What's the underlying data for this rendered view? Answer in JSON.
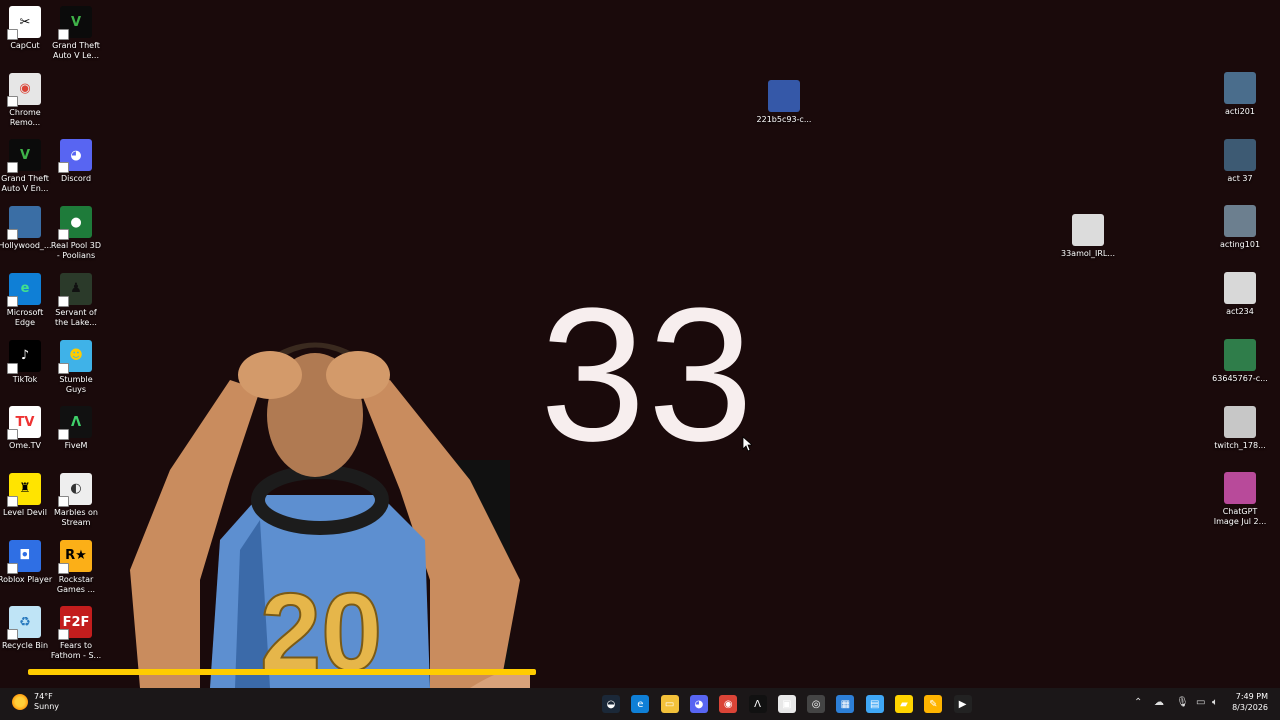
{
  "desktop_icons_left": [
    {
      "label": "CapCut",
      "icon": "capcut-icon",
      "color": "#ffffff",
      "glyph": "✂",
      "fg": "#000",
      "x": 0,
      "y": 0
    },
    {
      "label": "Grand Theft\nAuto V Le...",
      "icon": "gta-v-icon",
      "color": "#0b0b0b",
      "glyph": "V",
      "fg": "#3fb249",
      "x": 1,
      "y": 0
    },
    {
      "label": "Chrome\nRemo...",
      "icon": "chrome-remote-icon",
      "color": "#e6e6e6",
      "glyph": "◉",
      "fg": "#db4437",
      "x": 0,
      "y": 1
    },
    {
      "label": "Grand Theft\nAuto V En...",
      "icon": "gta-v-enhanced-icon",
      "color": "#0b0b0b",
      "glyph": "V",
      "fg": "#3fb249",
      "x": 0,
      "y": 2
    },
    {
      "label": "Discord",
      "icon": "discord-icon",
      "color": "#5865f2",
      "glyph": "◕",
      "fg": "#fff",
      "x": 1,
      "y": 2
    },
    {
      "label": "Hollywood_...",
      "icon": "hollywood-image-icon",
      "color": "#3a6ea5",
      "glyph": "",
      "fg": "#fff",
      "x": 0,
      "y": 3
    },
    {
      "label": "Real Pool 3D\n- Poolians",
      "icon": "real-pool-icon",
      "color": "#1e7b3a",
      "glyph": "●",
      "fg": "#fff",
      "x": 1,
      "y": 3
    },
    {
      "label": "Microsoft\nEdge",
      "icon": "edge-icon",
      "color": "#0f7fd6",
      "glyph": "e",
      "fg": "#41e08f",
      "x": 0,
      "y": 4
    },
    {
      "label": "Servant of\nthe Lake...",
      "icon": "servant-lake-icon",
      "color": "#2b3a2a",
      "glyph": "♟",
      "fg": "#111",
      "x": 1,
      "y": 4
    },
    {
      "label": "TikTok",
      "icon": "tiktok-icon",
      "color": "#000000",
      "glyph": "♪",
      "fg": "#fff",
      "x": 0,
      "y": 5
    },
    {
      "label": "Stumble\nGuys",
      "icon": "stumble-guys-icon",
      "color": "#3fb2e8",
      "glyph": "☻",
      "fg": "#ffcc00",
      "x": 1,
      "y": 5
    },
    {
      "label": "Ome.TV",
      "icon": "ome-tv-icon",
      "color": "#ffffff",
      "glyph": "TV",
      "fg": "#e33",
      "x": 0,
      "y": 6
    },
    {
      "label": "FiveM",
      "icon": "fivem-icon",
      "color": "#111111",
      "glyph": "Λ",
      "fg": "#3fd16a",
      "x": 1,
      "y": 6
    },
    {
      "label": "Level Devil",
      "icon": "level-devil-icon",
      "color": "#ffe400",
      "glyph": "♜",
      "fg": "#000",
      "x": 0,
      "y": 7
    },
    {
      "label": "Marbles on\nStream",
      "icon": "marbles-icon",
      "color": "#eeeeee",
      "glyph": "◐",
      "fg": "#333",
      "x": 1,
      "y": 7
    },
    {
      "label": "Roblox Player",
      "icon": "roblox-icon",
      "color": "#2f6fe4",
      "glyph": "◘",
      "fg": "#fff",
      "x": 0,
      "y": 8
    },
    {
      "label": "Rockstar\nGames ...",
      "icon": "rockstar-icon",
      "color": "#fcaf17",
      "glyph": "R★",
      "fg": "#000",
      "x": 1,
      "y": 8
    },
    {
      "label": "Recycle Bin",
      "icon": "recycle-bin-icon",
      "color": "#bfe4f6",
      "glyph": "♻",
      "fg": "#2b7bbf",
      "x": 0,
      "y": 9
    },
    {
      "label": "Fears to\nFathom - S...",
      "icon": "fears-to-fathom-icon",
      "color": "#c31d1d",
      "glyph": "F2F",
      "fg": "#fff",
      "x": 1,
      "y": 9
    }
  ],
  "desktop_icons_right": [
    {
      "label": "acti201",
      "icon": "video-thumbnail-icon",
      "color": "#4a6d8c",
      "row": 0
    },
    {
      "label": "act 37",
      "icon": "video-thumbnail-icon",
      "color": "#3d5a73",
      "row": 1
    },
    {
      "label": "acting101",
      "icon": "video-thumbnail-icon",
      "color": "#6c7f8f",
      "row": 2
    },
    {
      "label": "act234",
      "icon": "video-thumbnail-icon",
      "color": "#d8d8d8",
      "row": 3
    },
    {
      "label": "63645767-c...",
      "icon": "video-thumbnail-icon",
      "color": "#2f7d4a",
      "row": 4
    },
    {
      "label": "twitch_178...",
      "icon": "video-thumbnail-icon",
      "color": "#c7c7c7",
      "row": 5
    },
    {
      "label": "ChatGPT\nImage Jul 2...",
      "icon": "image-thumbnail-icon",
      "color": "#b84a9a",
      "row": 6
    }
  ],
  "desktop_icons_middle": [
    {
      "label": "221b5c93-c...",
      "icon": "video-thumbnail-icon",
      "color": "#3558a8"
    },
    {
      "label": "33amol_IRL...",
      "icon": "video-thumbnail-icon",
      "color": "#dcdcdc"
    }
  ],
  "counter": {
    "value": "33"
  },
  "weather": {
    "temp": "74°F",
    "condition": "Sunny"
  },
  "clock": {
    "time": "7:49 PM",
    "date": "8/3/2026"
  },
  "taskbar_apps": [
    {
      "icon": "steam-icon",
      "color": "#1b2838",
      "glyph": "◒"
    },
    {
      "icon": "edge-icon",
      "color": "#0f7fd6",
      "glyph": "e"
    },
    {
      "icon": "file-explorer-icon",
      "color": "#f3c13a",
      "glyph": "▭"
    },
    {
      "icon": "discord-icon",
      "color": "#5865f2",
      "glyph": "◕"
    },
    {
      "icon": "chrome-icon",
      "color": "#db4437",
      "glyph": "◉"
    },
    {
      "icon": "fivem-icon",
      "color": "#111111",
      "glyph": "Λ"
    },
    {
      "icon": "capture-icon",
      "color": "#e8e8e8",
      "glyph": "▣"
    },
    {
      "icon": "obs-icon",
      "color": "#444444",
      "glyph": "◎"
    },
    {
      "icon": "store-icon",
      "color": "#2d7fd6",
      "glyph": "▦"
    },
    {
      "icon": "notes-icon",
      "color": "#3fa7f5",
      "glyph": "▤"
    },
    {
      "icon": "sticky-notes-icon",
      "color": "#ffd400",
      "glyph": "▰"
    },
    {
      "icon": "pencil-icon",
      "color": "#ffb400",
      "glyph": "✎"
    },
    {
      "icon": "media-player-icon",
      "color": "#222222",
      "glyph": "▶"
    }
  ],
  "tray_icons": [
    "chevron-up-icon",
    "cloud-icon",
    "microphone-icon",
    "display-icon",
    "speaker-icon"
  ]
}
